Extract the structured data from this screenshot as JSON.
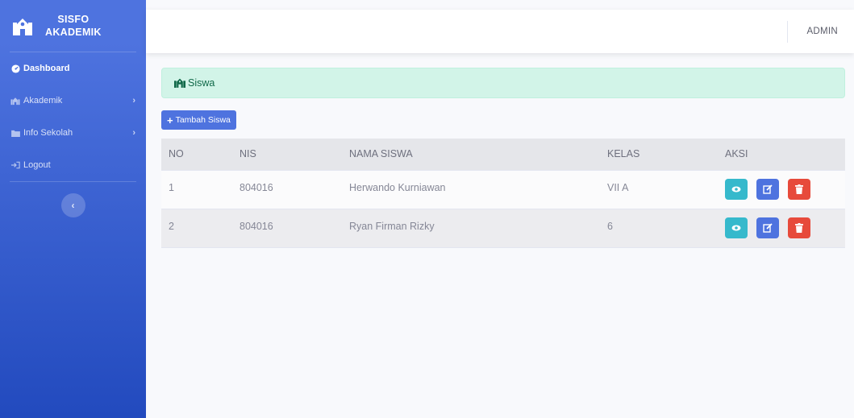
{
  "brand": {
    "line1": "SISFO",
    "line2": "AKADEMIK",
    "icon": "school-icon"
  },
  "sidebar": {
    "items": [
      {
        "label": "Dashboard",
        "icon": "tachometer-icon",
        "active": true
      },
      {
        "label": "Akademik",
        "icon": "school-icon",
        "chevron": "›"
      },
      {
        "label": "Info Sekolah",
        "icon": "folder-icon",
        "chevron": "›"
      },
      {
        "label": "Logout",
        "icon": "sign-out-icon"
      }
    ],
    "toggle": "‹"
  },
  "topbar": {
    "user": "ADMIN"
  },
  "page": {
    "heading": "Siswa",
    "add_button": "Tambah Siswa"
  },
  "table": {
    "headers": [
      "NO",
      "NIS",
      "NAMA SISWA",
      "KELAS",
      "AKSI"
    ],
    "rows": [
      {
        "no": "1",
        "nis": "804016",
        "nama": "Herwando Kurniawan",
        "kelas": "VII A"
      },
      {
        "no": "2",
        "nis": "804016",
        "nama": "Ryan Firman Rizky",
        "kelas": "6"
      }
    ]
  },
  "colors": {
    "primary": "#4e73df",
    "info": "#36b9cc",
    "danger": "#e74a3b",
    "success_bg": "#d2f4e8"
  }
}
